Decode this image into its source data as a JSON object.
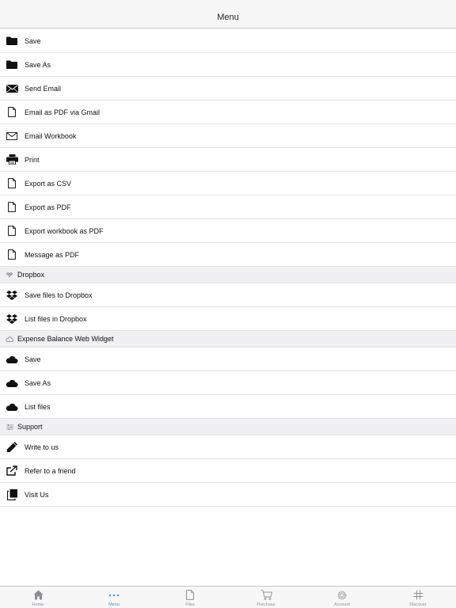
{
  "header": {
    "title": "Menu"
  },
  "menu_items": [
    {
      "label": "Save",
      "icon": "folder-icon"
    },
    {
      "label": "Save As",
      "icon": "folder-icon"
    },
    {
      "label": "Send Email",
      "icon": "envelope-filled-icon"
    },
    {
      "label": "Email as PDF via Gmail",
      "icon": "document-icon"
    },
    {
      "label": "Email Workbook",
      "icon": "envelope-outline-icon"
    },
    {
      "label": "Print",
      "icon": "printer-icon"
    },
    {
      "label": "Export as CSV",
      "icon": "document-icon"
    },
    {
      "label": "Export as PDF",
      "icon": "document-icon"
    },
    {
      "label": "Export workbook as PDF",
      "icon": "document-icon"
    },
    {
      "label": "Message as PDF",
      "icon": "document-icon"
    }
  ],
  "sections": {
    "dropbox": {
      "title": "Dropbox",
      "icon": "dropbox-icon",
      "items": [
        {
          "label": "Save files to Dropbox",
          "icon": "dropbox-icon"
        },
        {
          "label": "List files in Dropbox",
          "icon": "dropbox-icon"
        }
      ]
    },
    "widget": {
      "title": "Expense Balance Web Widget",
      "icon": "cloud-outline-icon",
      "items": [
        {
          "label": "Save",
          "icon": "cloud-icon"
        },
        {
          "label": "Save As",
          "icon": "cloud-icon"
        },
        {
          "label": "List files",
          "icon": "cloud-icon"
        }
      ]
    },
    "support": {
      "title": "Support",
      "icon": "sliders-icon",
      "items": [
        {
          "label": "Write to us",
          "icon": "pencil-icon"
        },
        {
          "label": "Refer to a friend",
          "icon": "share-icon"
        },
        {
          "label": "Visit Us",
          "icon": "copy-icon"
        }
      ]
    }
  },
  "tabbar": {
    "active": "Menu",
    "tabs": [
      {
        "label": "Home",
        "icon": "home-icon"
      },
      {
        "label": "Menu",
        "icon": "more-dots-icon"
      },
      {
        "label": "Files",
        "icon": "file-icon"
      },
      {
        "label": "Purchase",
        "icon": "cart-icon"
      },
      {
        "label": "Account",
        "icon": "gear-icon"
      },
      {
        "label": "Discover",
        "icon": "hash-icon"
      }
    ]
  },
  "colors": {
    "accent": "#3b8fe8",
    "section_bg": "#f0f0f2",
    "bar_bg": "#f7f7f7"
  }
}
